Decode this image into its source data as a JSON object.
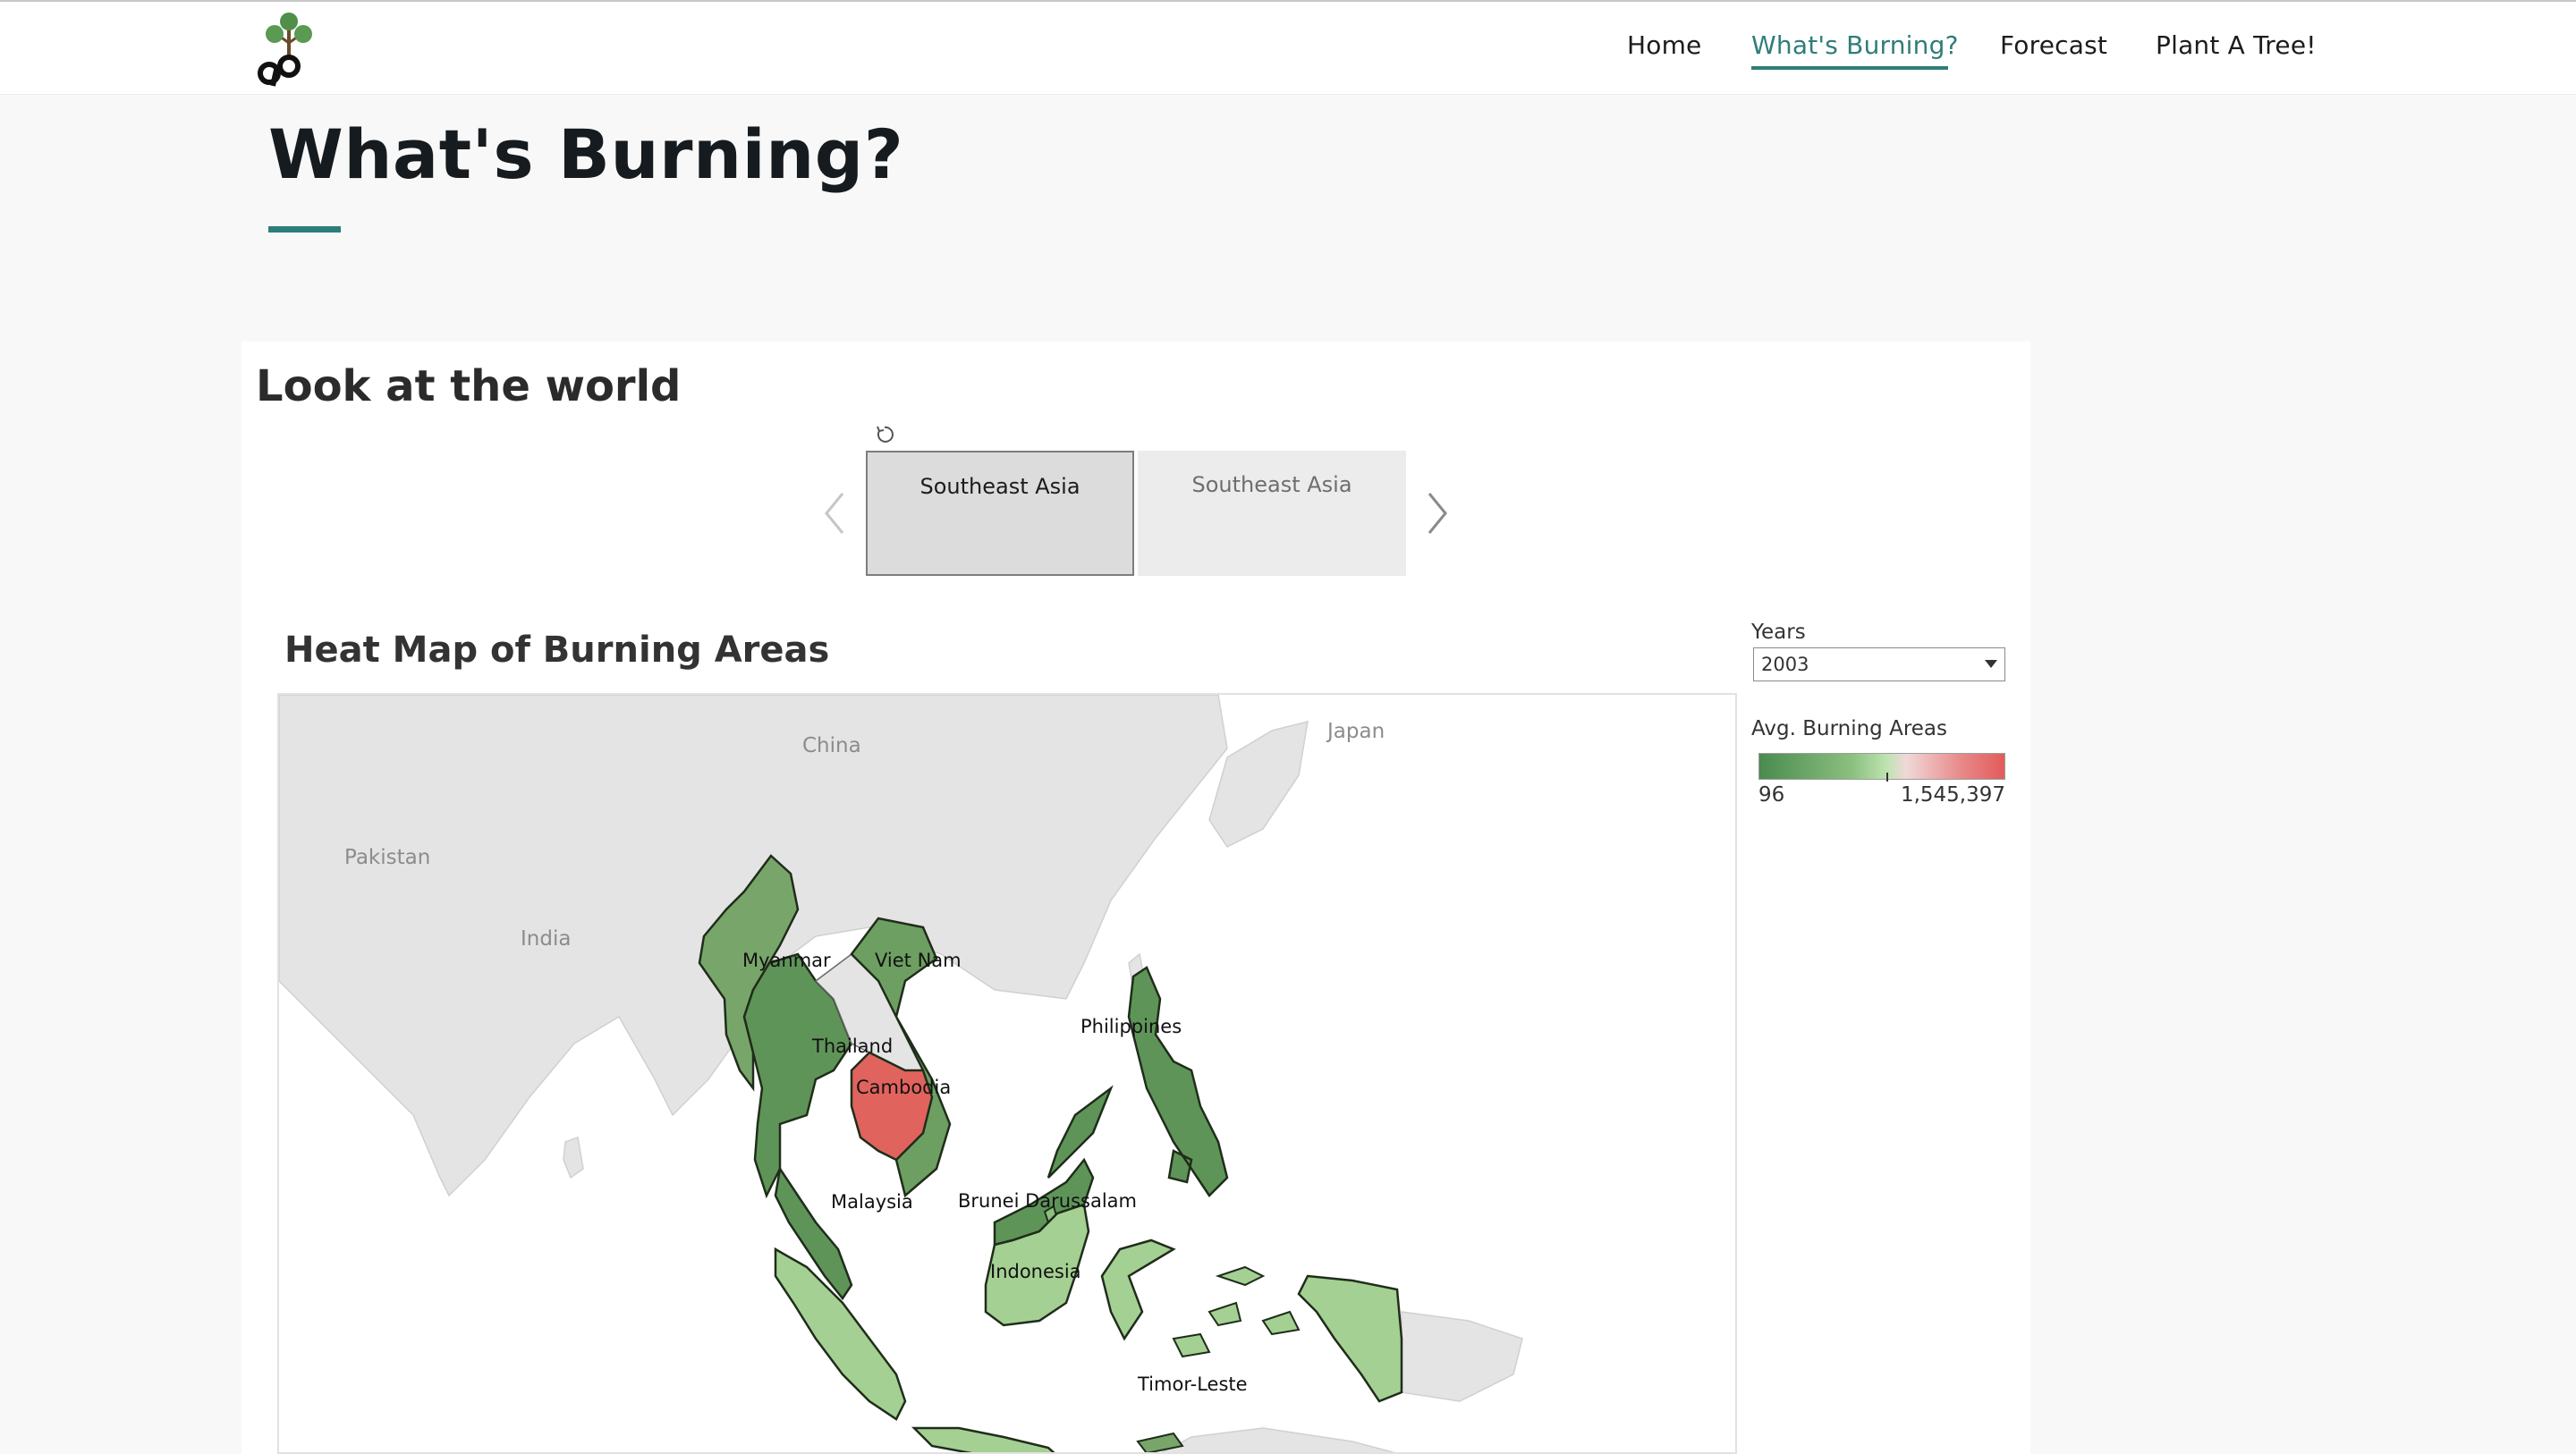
{
  "nav": {
    "items": [
      {
        "label": "Home"
      },
      {
        "label": "What's Burning?"
      },
      {
        "label": "Forecast"
      },
      {
        "label": "Plant A Tree!"
      }
    ],
    "active_color": "#2f7d7a"
  },
  "page": {
    "title": "What's Burning?"
  },
  "story": {
    "title": "Look at the world",
    "points": [
      {
        "label": "Southeast Asia"
      },
      {
        "label": "Southeast Asia"
      }
    ]
  },
  "sheet": {
    "title": "Heat Map of Burning Areas"
  },
  "map": {
    "background_labels": [
      "China",
      "Japan",
      "Pakistan",
      "India"
    ],
    "country_labels": [
      "Myanmar",
      "Viet Nam",
      "Thailand",
      "Cambodia",
      "Philippines",
      "Malaysia",
      "Brunei Darussalam",
      "Indonesia",
      "Timor-Leste"
    ]
  },
  "filter": {
    "label": "Years",
    "selected": "2003"
  },
  "legend": {
    "title": "Avg. Burning Areas",
    "min": "96",
    "max": "1,545,397",
    "colors": {
      "low": "#4a8b4f",
      "mid": "#bfe3b1",
      "high": "#e25b5b"
    }
  }
}
